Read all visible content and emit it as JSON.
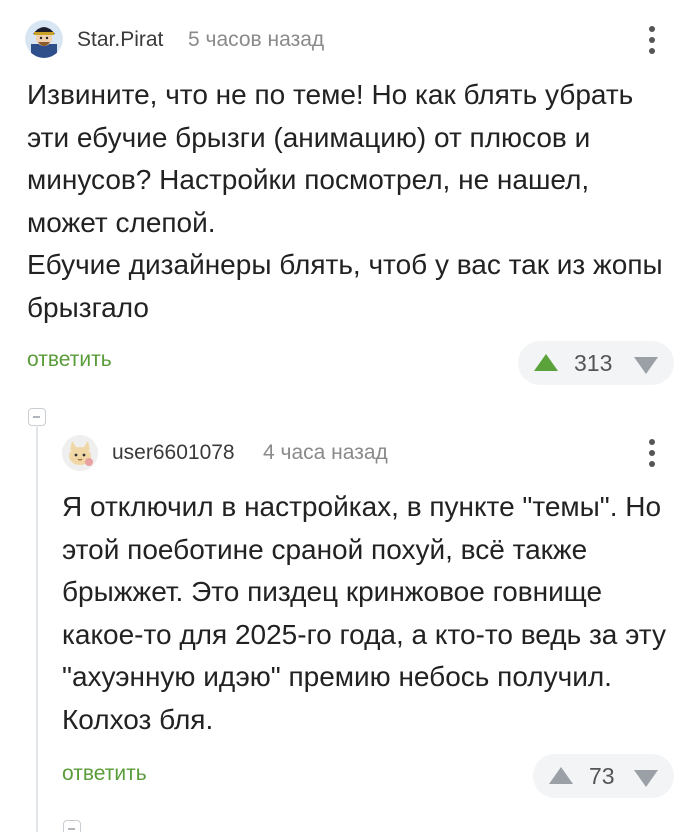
{
  "comments": [
    {
      "author": "Star.Pirat",
      "time": "5 часов назад",
      "avatar_icon": "pirate-avatar-icon",
      "body": "Извините, что не по теме! Но как блять убрать эти ебучие брызги (анимацию) от плюсов и минусов? Настройки посмотрел, не нашел, может слепой.\nЕбучие дизайнеры блять, чтоб у вас так из жопы брызгало",
      "reply_label": "ответить",
      "score": "313",
      "upvoted": true
    },
    {
      "author": "user6601078",
      "time": "4 часа назад",
      "avatar_icon": "cat-avatar-icon",
      "body": "Я отключил в настройках, в пункте \"темы\". Но этой поеботине сраной похуй, всё также брыжжет. Это пиздец кринжовое говнище какое-то для 2025-го года, а кто-то ведь за эту \"ахуэнную идэю\" премию небось получил. Колхоз бля.",
      "reply_label": "ответить",
      "score": "73",
      "upvoted": false
    }
  ],
  "colors": {
    "reply_link": "#5a9c3a",
    "upvote_active": "#5aa33b",
    "vote_inactive": "#9aa0a6",
    "vote_box_bg": "#f2f4f6",
    "time_text": "#8a8a8a"
  }
}
